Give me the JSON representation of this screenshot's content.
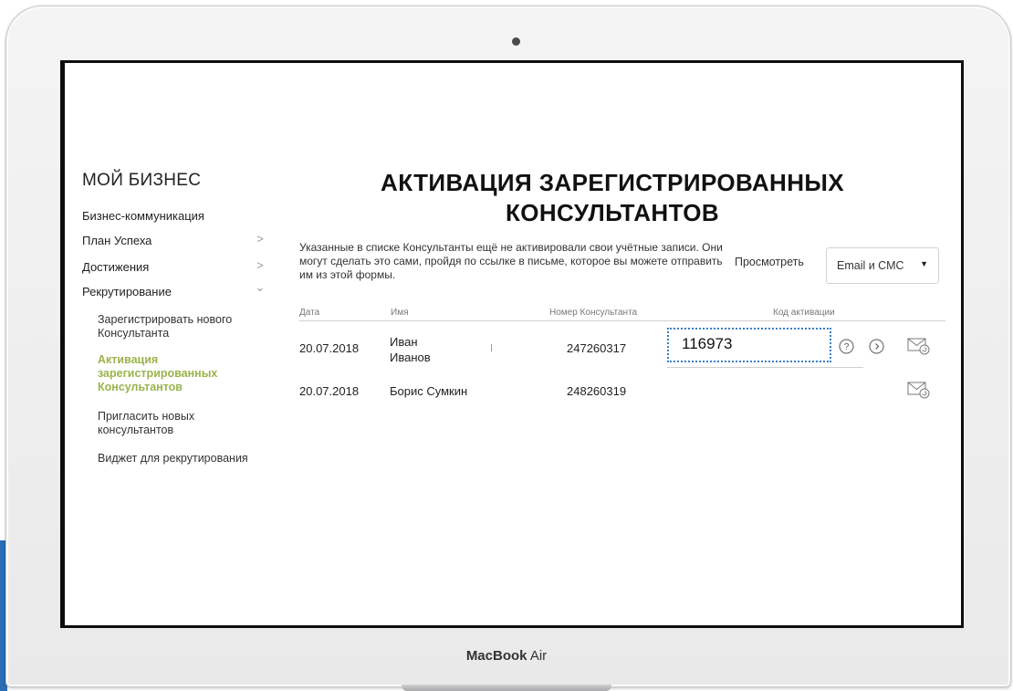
{
  "device": {
    "brand": "MacBook",
    "model": "Air"
  },
  "sidebar": {
    "heading": "МОЙ БИЗНЕС",
    "items": [
      {
        "label": "Бизнес-коммуникация",
        "chevron": ""
      },
      {
        "label": "План Успеха",
        "chevron": ">"
      },
      {
        "label": "Достижения",
        "chevron": ">"
      },
      {
        "label": "Рекрутирование",
        "chevron": "⌄"
      }
    ],
    "subitems": [
      {
        "label": "Зарегистрировать нового Консультанта",
        "active": false
      },
      {
        "label": "Активация зарегистрированных Консультантов",
        "active": true
      },
      {
        "label": "Пригласить новых консультантов",
        "active": false
      },
      {
        "label": "Виджет для рекрутирования",
        "active": false
      }
    ]
  },
  "main": {
    "title_line1": "АКТИВАЦИЯ ЗАРЕГИСТРИРОВАННЫХ",
    "title_line2": "КОНСУЛЬТАНТОВ",
    "intro": "Указанные в списке Консультанты ещё не активировали свои учётные записи. Они могут сделать это сами, пройдя по ссылке в письме, которое вы можете отправить им из этой формы.",
    "view_label": "Просмотреть",
    "view_select_value": "Email и СМС"
  },
  "table": {
    "headers": {
      "date": "Дата",
      "name": "Имя",
      "number": "Номер Консультанта",
      "code": "Код активации"
    },
    "rows": [
      {
        "date": "20.07.2018",
        "name_line1": "Иван",
        "name_line2": "Иванов",
        "number": "247260317",
        "code": "116973"
      },
      {
        "date": "20.07.2018",
        "name_line1": "Борис Сумкин",
        "name_line2": "",
        "number": "248260319",
        "code": ""
      }
    ]
  },
  "icons": {
    "help": "question-circle-icon",
    "next": "arrow-right-circle-icon",
    "send": "envelope-refresh-icon"
  },
  "colors": {
    "accent_green": "#9bb34b",
    "focus_blue": "#3b7fc4"
  }
}
